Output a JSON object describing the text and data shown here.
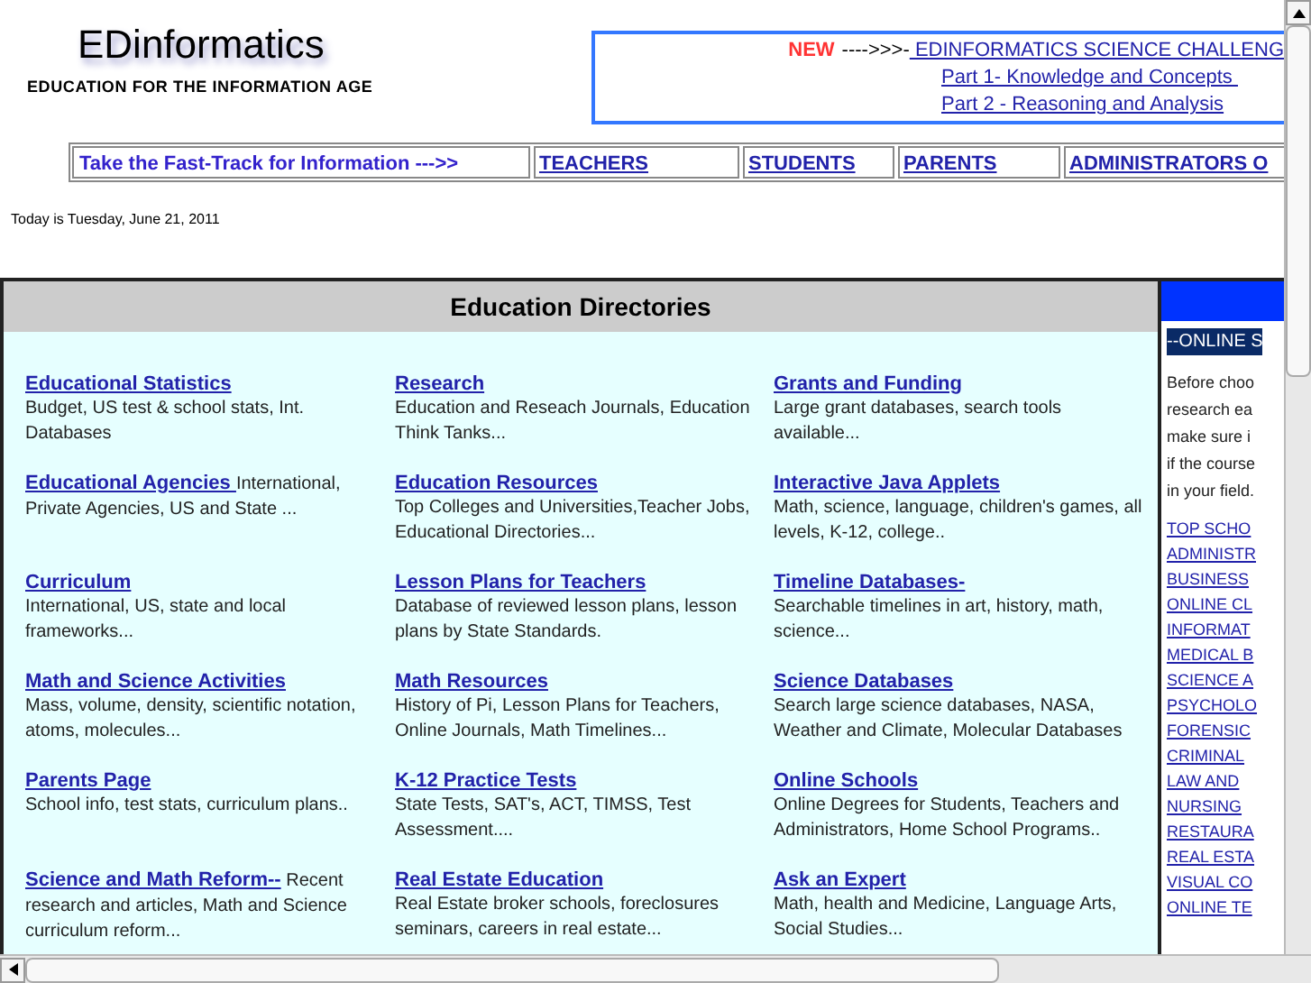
{
  "header": {
    "logo": "EDinformatics",
    "tagline": "EDUCATION FOR THE INFORMATION AGE"
  },
  "challenge": {
    "badge": "NEW",
    "arrow": "---->>>-",
    "link": " EDINFORMATICS SCIENCE CHALLENG",
    "parts": [
      "Part 1- Knowledge and Concepts ",
      "Part 2 - Reasoning and Analysis"
    ]
  },
  "nav": {
    "label": "Take the Fast-Track for Information --->>",
    "links": [
      "TEACHERS",
      "STUDENTS",
      "PARENTS",
      "ADMINISTRATORS O"
    ]
  },
  "date": "Today is Tuesday, June 21, 2011",
  "directories": {
    "title": "Education Directories",
    "items": [
      {
        "kind": "block",
        "title": "Educational Statistics",
        "description": "Budget, US test & school stats, Int. Databases"
      },
      {
        "kind": "block",
        "title": "Research",
        "description": "Education and Reseach Journals, Education Think Tanks..."
      },
      {
        "kind": "block",
        "title": "Grants and Funding",
        "description": "Large grant databases, search tools available..."
      },
      {
        "kind": "inline",
        "title": "Educational Agencies ",
        "description": "International, Private Agencies, US and State ..."
      },
      {
        "kind": "block",
        "title": "Education Resources",
        "description": "Top Colleges and Universities,Teacher Jobs, Educational Directories..."
      },
      {
        "kind": "block",
        "title": "Interactive Java Applets",
        "description": "Math, science, language, children's games, all levels, K-12, college.."
      },
      {
        "kind": "block",
        "title": "Curriculum",
        "description": "International, US, state and local frameworks..."
      },
      {
        "kind": "block",
        "title": "Lesson Plans for Teachers ",
        "description": "Database of reviewed lesson plans, lesson plans by State Standards."
      },
      {
        "kind": "block",
        "title": "Timeline Databases-",
        "description": "Searchable timelines in art, history, math, science..."
      },
      {
        "kind": "block",
        "title": "Math and Science Activities",
        "description": "Mass, volume, density, scientific notation, atoms, molecules..."
      },
      {
        "kind": "block",
        "title": "Math Resources ",
        "description": "History of Pi, Lesson Plans for Teachers, Online Journals, Math Timelines..."
      },
      {
        "kind": "block",
        "title": "Science Databases ",
        "description": "Search large science databases, NASA, Weather and Climate, Molecular Databases"
      },
      {
        "kind": "block",
        "title": "Parents Page ",
        "description": "School info, test stats, curriculum plans.."
      },
      {
        "kind": "block",
        "title": "K-12 Practice Tests ",
        "description": "State Tests, SAT's, ACT, TIMSS, Test Assessment...."
      },
      {
        "kind": "block",
        "title": "Online Schools",
        "description": "Online Degrees for Students, Teachers and Administrators, Home School Programs.."
      },
      {
        "kind": "inline",
        "title": "Science and Math Reform--",
        "description": "Recent research and articles, Math and Science curriculum reform..."
      },
      {
        "kind": "block",
        "title": "Real Estate Education",
        "description": "Real Estate broker schools, foreclosures seminars, careers in real estate..."
      },
      {
        "kind": "block",
        "title": "Ask an Expert",
        "description": "Math, health and Medicine, Language Arts, Social Studies..."
      }
    ]
  },
  "side_panel": {
    "banner": "--ONLINE S",
    "intro": [
      "Before choo",
      "research ea",
      "make sure i",
      "if the course",
      "in your field."
    ],
    "links": [
      "TOP SCHO",
      "ADMINISTR",
      "BUSINESS",
      "ONLINE CL",
      "INFORMAT",
      "MEDICAL B",
      "SCIENCE A",
      "PSYCHOLO",
      "FORENSIC",
      "CRIMINAL",
      "LAW AND",
      "NURSING",
      "RESTAURA",
      "REAL ESTA",
      "VISUAL CO",
      "ONLINE TE"
    ]
  }
}
